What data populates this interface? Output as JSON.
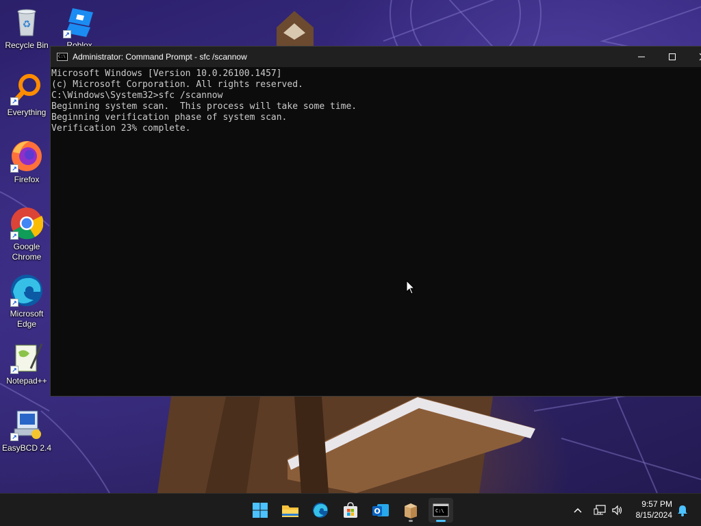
{
  "desktop": {
    "icons": [
      {
        "label": "Recycle Bin"
      },
      {
        "label": "Roblox Studio"
      },
      {
        "label": "Everything"
      },
      {
        "label": "Firefox"
      },
      {
        "label": "Google Chrome"
      },
      {
        "label": "Microsoft Edge"
      },
      {
        "label": "Notepad++"
      },
      {
        "label": "EasyBCD 2.4"
      }
    ]
  },
  "window": {
    "title": "Administrator: Command Prompt - sfc  /scannow",
    "console_lines": [
      "Microsoft Windows [Version 10.0.26100.1457]",
      "(c) Microsoft Corporation. All rights reserved.",
      "",
      "C:\\Windows\\System32>sfc /scannow",
      "",
      "Beginning system scan.  This process will take some time.",
      "",
      "Beginning verification phase of system scan.",
      "Verification 23% complete."
    ]
  },
  "taskbar": {
    "apps": [
      "start-icon",
      "file-explorer-icon",
      "edge-icon",
      "store-icon",
      "outlook-icon",
      "package-icon",
      "terminal-icon"
    ],
    "clock": {
      "time": "9:57 PM",
      "date": "8/15/2024"
    },
    "accent": "#4cc2ff"
  }
}
